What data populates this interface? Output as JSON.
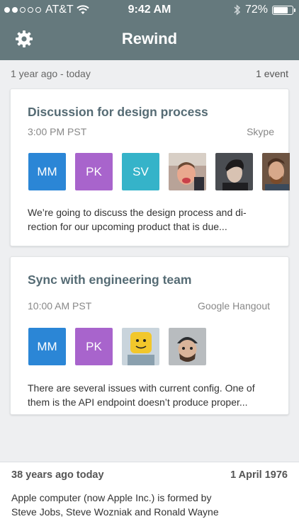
{
  "status_bar": {
    "carrier": "AT&T",
    "time": "9:42 AM",
    "battery": "72%",
    "battery_level": 0.72,
    "signal_bars": 2
  },
  "header": {
    "title": "Rewind",
    "settings_icon": "gear-icon"
  },
  "range": {
    "label": "1 year ago - today",
    "count": "1 event"
  },
  "events": [
    {
      "title": "Discussion for design process",
      "time": "3:00 PM PST",
      "service": "Skype",
      "participants": [
        {
          "initials": "MM",
          "color": "#2b86d6"
        },
        {
          "initials": "PK",
          "color": "#a864cc"
        },
        {
          "initials": "SV",
          "color": "#35b3c9"
        }
      ],
      "description": "We’re going to discuss the design process and di-\nrection for our upcoming product that is due..."
    },
    {
      "title": "Sync with engineering team",
      "time": "10:00 AM PST",
      "service": "Google Hangout",
      "participants": [
        {
          "initials": "MM",
          "color": "#2b86d6"
        },
        {
          "initials": "PK",
          "color": "#a864cc"
        }
      ],
      "description": "There are several issues with current config. One of\nthem is the API endpoint doesn’t produce proper..."
    }
  ],
  "on_this_day": {
    "label": "38 years ago today",
    "date": "1 April 1976",
    "text": "Apple computer (now Apple Inc.) is formed by\nSteve Jobs, Steve Wozniak and Ronald Wayne"
  }
}
